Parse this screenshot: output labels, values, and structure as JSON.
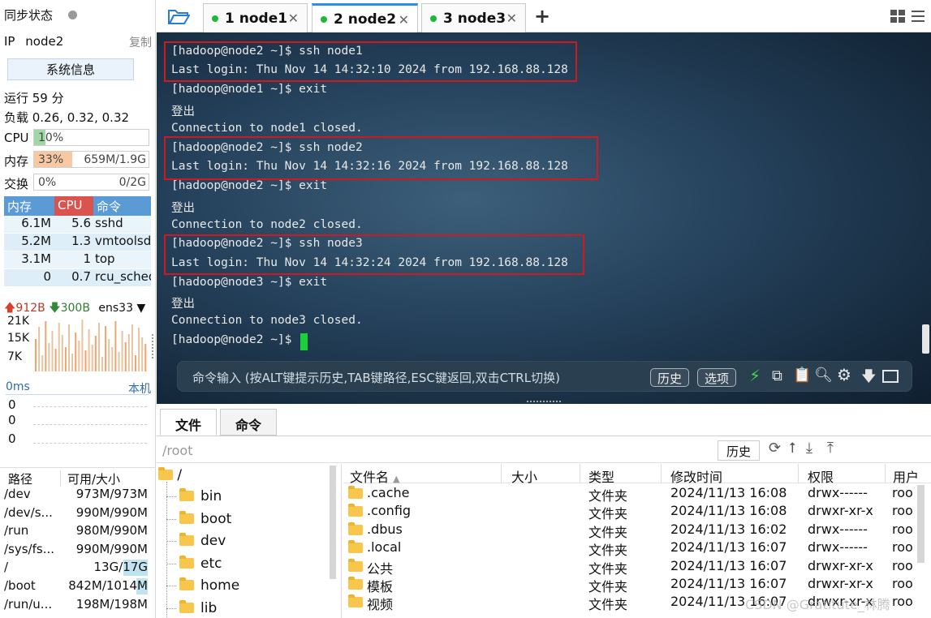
{
  "left": {
    "sync_label": "同步状态",
    "ip_label": "IP",
    "ip_value": "node2",
    "copy_label": "复制",
    "sysinfo_button": "系统信息",
    "uptime": "运行 59 分",
    "load": "负载 0.26, 0.32, 0.32",
    "cpu_label": "CPU",
    "cpu_value": "10%",
    "cpu_fraction": 0.1,
    "mem_label": "内存",
    "mem_value": "33%",
    "mem_detail": "659M/1.9G",
    "mem_fraction": 0.33,
    "swap_label": "交换",
    "swap_value": "0%",
    "swap_detail": "0/2G",
    "swap_fraction": 0.0,
    "proc_headers": [
      "内存",
      "CPU",
      "命令"
    ],
    "procs": [
      [
        "6.1M",
        "5.6",
        "sshd"
      ],
      [
        "5.2M",
        "1.3",
        "vmtoolsd"
      ],
      [
        "3.1M",
        "1",
        "top"
      ],
      [
        "0",
        "0.7",
        "rcu_sched"
      ]
    ],
    "net_up": "912B",
    "net_down": "300B",
    "net_iface": "ens33",
    "net_ticks": [
      "21K",
      "15K",
      "7K"
    ],
    "ping_label": "0ms",
    "ping_host": "本机",
    "ping_values": [
      "0",
      "0",
      "0"
    ],
    "mount_headers": [
      "路径",
      "可用/大小"
    ],
    "mounts": [
      [
        "/dev",
        "973M/973M"
      ],
      [
        "/dev/s...",
        "990M/990M"
      ],
      [
        "/run",
        "980M/990M"
      ],
      [
        "/sys/fs...",
        "990M/990M"
      ],
      [
        "/",
        "13G/17G"
      ],
      [
        "/boot",
        "842M/1014M"
      ],
      [
        "/run/u...",
        "198M/198M"
      ]
    ]
  },
  "tabs": [
    {
      "label": "1 node1"
    },
    {
      "label": "2 node2"
    },
    {
      "label": "3 node3"
    }
  ],
  "add_tab": "+",
  "terminal": {
    "lines": [
      "[hadoop@node2 ~]$ ssh node1",
      "Last login: Thu Nov 14 14:32:10 2024 from 192.168.88.128",
      "[hadoop@node1 ~]$ exit",
      "登出",
      "Connection to node1 closed.",
      "[hadoop@node2 ~]$ ssh node2",
      "Last login: Thu Nov 14 14:32:16 2024 from 192.168.88.128",
      "[hadoop@node2 ~]$ exit",
      "登出",
      "Connection to node2 closed.",
      "[hadoop@node2 ~]$ ssh node3",
      "Last login: Thu Nov 14 14:32:24 2024 from 192.168.88.128",
      "[hadoop@node3 ~]$ exit",
      "登出",
      "Connection to node3 closed.",
      "[hadoop@node2 ~]$ "
    ],
    "cmd_placeholder": "命令输入 (按ALT键提示历史,TAB键路径,ESC键返回,双击CTRL切换)",
    "history_btn": "历史",
    "options_btn": "选项"
  },
  "bottom": {
    "tabs": [
      "文件",
      "命令"
    ],
    "path": "/root",
    "history_btn": "历史",
    "tree_root": "/",
    "tree": [
      "bin",
      "boot",
      "dev",
      "etc",
      "home",
      "lib"
    ],
    "file_headers": [
      "文件名",
      "大小",
      "类型",
      "修改时间",
      "权限",
      "用户"
    ],
    "files": [
      [
        ".cache",
        "",
        "文件夹",
        "2024/11/13 16:08",
        "drwx------",
        "roo"
      ],
      [
        ".config",
        "",
        "文件夹",
        "2024/11/13 16:08",
        "drwxr-xr-x",
        "roo"
      ],
      [
        ".dbus",
        "",
        "文件夹",
        "2024/11/13 16:02",
        "drwx------",
        "roo"
      ],
      [
        ".local",
        "",
        "文件夹",
        "2024/11/13 16:07",
        "drwx------",
        "roo"
      ],
      [
        "公共",
        "",
        "文件夹",
        "2024/11/13 16:07",
        "drwxr-xr-x",
        "roo"
      ],
      [
        "模板",
        "",
        "文件夹",
        "2024/11/13 16:07",
        "drwxr-xr-x",
        "roo"
      ],
      [
        "视频",
        "",
        "文件夹",
        "2024/11/13 16:07",
        "drwxr-xr-x",
        "roo"
      ]
    ],
    "watermark": "CSDN @Gratitute_林腾"
  }
}
